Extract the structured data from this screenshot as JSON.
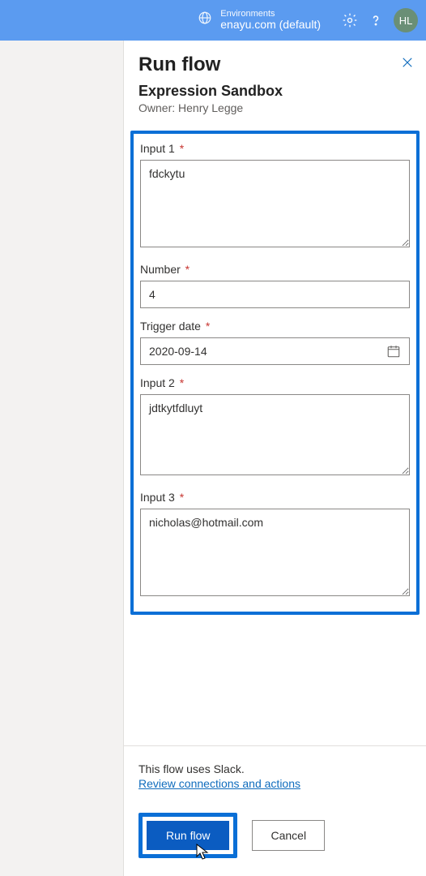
{
  "header": {
    "env_label": "Environments",
    "env_value": "enayu.com (default)",
    "avatar_initials": "HL"
  },
  "panel": {
    "title": "Run flow",
    "flow_name": "Expression Sandbox",
    "owner_line": "Owner: Henry Legge"
  },
  "form": {
    "input1": {
      "label": "Input 1",
      "value": "fdckytu"
    },
    "number": {
      "label": "Number",
      "value": "4"
    },
    "trigger_date": {
      "label": "Trigger date",
      "value": "2020-09-14"
    },
    "input2": {
      "label": "Input 2",
      "value": "jdtkytfdluyt"
    },
    "input3": {
      "label": "Input 3",
      "value": "nicholas@hotmail.com"
    }
  },
  "footer": {
    "conn_text": "This flow uses Slack.",
    "review_link": "Review connections and actions",
    "run_label": "Run flow",
    "cancel_label": "Cancel"
  }
}
